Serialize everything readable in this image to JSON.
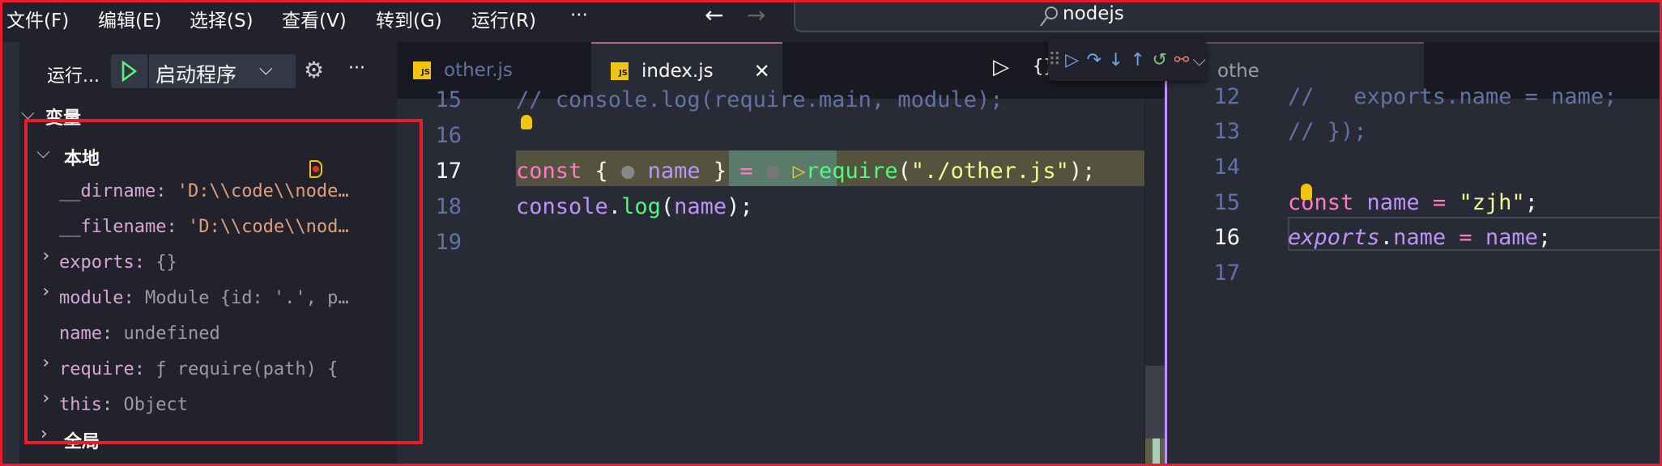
{
  "menu": [
    "文件(F)",
    "编辑(E)",
    "选择(S)",
    "查看(V)",
    "转到(G)",
    "运行(R)",
    "···"
  ],
  "search": {
    "value": "nodejs"
  },
  "sidebar": {
    "title": "运行...",
    "config": "启动程序",
    "section": "变量",
    "local": "本地",
    "global": "全局",
    "vars": [
      {
        "key": "__dirname",
        "value": "'D:\\\\code\\\\node…",
        "type": "str",
        "expandable": false
      },
      {
        "key": "__filename",
        "value": "'D:\\\\code\\\\nod…",
        "type": "str",
        "expandable": false
      },
      {
        "key": "exports",
        "value": "{}",
        "type": "obj",
        "expandable": true
      },
      {
        "key": "module",
        "value": "Module {id: '.', p…",
        "type": "obj",
        "expandable": true
      },
      {
        "key": "name",
        "value": "undefined",
        "type": "obj",
        "expandable": false
      },
      {
        "key": "require",
        "value": "ƒ require(path) {",
        "type": "obj",
        "expandable": true
      },
      {
        "key": "this",
        "value": "Object",
        "type": "obj",
        "expandable": true
      }
    ]
  },
  "tabs": {
    "left": [
      {
        "label": "other.js"
      },
      {
        "label": "index.js",
        "active": true
      }
    ],
    "right": [
      {
        "label": "othe"
      }
    ]
  },
  "editor1": {
    "lines": [
      "15",
      "16",
      "17",
      "18",
      "19"
    ],
    "line15": "// console.log(require.main, module);"
  },
  "editor2": {
    "lines": [
      "12",
      "13",
      "14",
      "15",
      "16",
      "17"
    ],
    "line12": "//   exports.name = name;",
    "line13": "// });"
  },
  "colors": {
    "accent": "#bd93f9",
    "frame": "#e81c2a",
    "current_line": "#53533e"
  }
}
